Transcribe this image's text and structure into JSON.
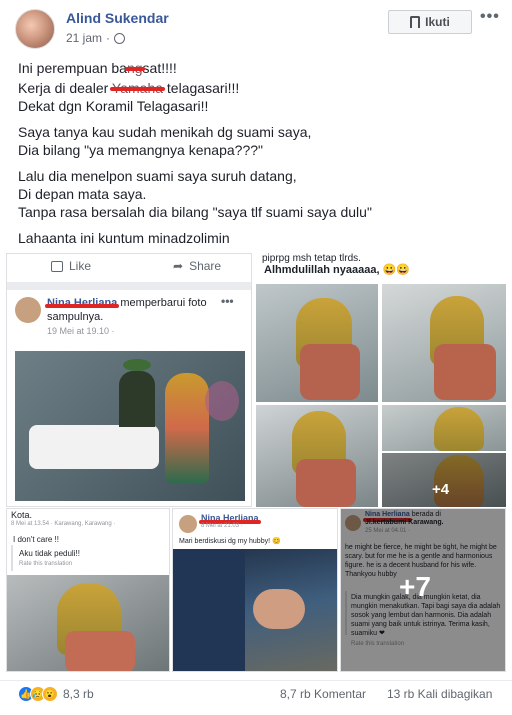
{
  "post": {
    "author": "Alind Sukendar",
    "time": "21 jam",
    "follow_label": "Ikuti",
    "more_label": "•••",
    "lines": [
      "Ini perempuan ba",
      "sat!!!!",
      "Kerja di dealer ",
      "telagasari!!!",
      "Dekat dgn Koramil Telagasari!!",
      "Saya tanya kau sudah menikah dg suami saya,",
      "Dia bilang \"ya memangnya kenapa???\"",
      "Lalu dia menelpon suami saya suruh datang,",
      "Di depan mata saya.",
      "Tanpa rasa bersalah dia bilang \"saya tlf suami saya dulu\"",
      "Lahaanta ini kuntum minadzolimin"
    ]
  },
  "left_card": {
    "like_label": "Like",
    "share_label": "Share",
    "name": "Nina Herliana",
    "action": " memperbarui foto sampulnya.",
    "meta": "19 Mei at 19.10 ·"
  },
  "right_top": {
    "caption": "Alhmdulillah nyaaaaa, 😀😀",
    "top_text": "piprpg msh tetap tlrds.",
    "more_count": "+4"
  },
  "bottom_left": {
    "top": "Kota.",
    "meta": "8 Mei at 13.54 · Karawang, Karawang ·",
    "text1": "I don't care !!",
    "text2": "Aku tidak peduli!!",
    "rate": "Rate this translation"
  },
  "bottom_mid": {
    "name": "Nina Herliana",
    "meta": "8 Mei at 21.03 ·",
    "text": "Mari berdiskusi dg my hubby! 😊"
  },
  "bottom_right": {
    "name": "Nina Herliana",
    "action": " berada di",
    "place": "Jl.kertabumi Karawang.",
    "meta": "25 Mei at 04.01 ·",
    "en": "he might be fierce, he might be tight, he might be scary. but for me he is a gentle and harmonious figure. he is a decent husband for his wife. Thankyou hubby",
    "id": "Dia mungkin galak, dia mungkin ketat, dia mungkin menakutkan. Tapi bagi saya dia adalah sosok yang lembut dan harmonis. Dia adalah suami yang baik untuk istrinya. Terima kasih, suamiku ❤",
    "rate": "Rate this translation",
    "more_count": "+7"
  },
  "footer": {
    "reactions": "8,3 rb",
    "comments": "8,7 rb Komentar",
    "shares": "13 rb Kali dibagikan"
  },
  "colors": {
    "link": "#385898",
    "accent_red": "#e02525",
    "like_blue": "#1877f2"
  }
}
